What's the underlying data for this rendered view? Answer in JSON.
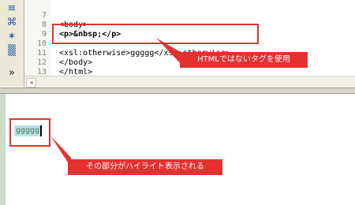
{
  "toolbar": {
    "icons": [
      "format-icon",
      "split-icon",
      "star-icon",
      "grid-icon",
      "chevron-down-icon"
    ]
  },
  "editor": {
    "lines": [
      {
        "num": "7",
        "text": "<body>"
      },
      {
        "num": "8",
        "text": "<p>&nbsp;</p>"
      },
      {
        "num": "9",
        "text": ""
      },
      {
        "num": "10",
        "text": "<xsl:otherwise>ggggg</xsl:otherwise>"
      },
      {
        "num": "11",
        "text": "</body>"
      },
      {
        "num": "12",
        "text": "</html>"
      },
      {
        "num": "13",
        "text": ""
      }
    ]
  },
  "preview": {
    "highlighted_text": "ggggg"
  },
  "annotations": {
    "top_callout": "HTMLではないタグを使用",
    "bottom_callout": "その部分がハイライト表示される"
  },
  "colors": {
    "annotation_red": "#e53030",
    "highlight": "#b9e3e6"
  }
}
